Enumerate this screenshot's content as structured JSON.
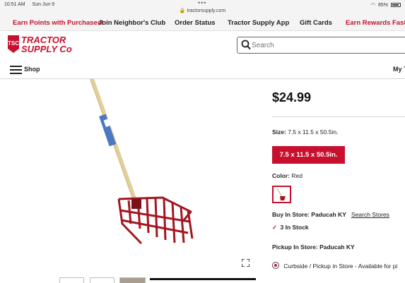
{
  "status_bar": {
    "time": "10:51 AM",
    "date": "Sun Jun 9",
    "url": "tractorsupply.com",
    "battery": "85%"
  },
  "promo_bar": {
    "earn_points": "Earn Points with Purchases!",
    "neighbors_club": "Join Neighbor's Club",
    "order_status": "Order Status",
    "app": "Tractor Supply App",
    "gift_cards": "Gift Cards",
    "earn_rewards": "Earn Rewards Faster"
  },
  "header": {
    "logo_text": "TRACTOR SUPPLY CO",
    "logo_badge": "TSC",
    "search_placeholder": "Search"
  },
  "nav": {
    "shop": "Shop",
    "my_account": "My T"
  },
  "product": {
    "price": "$24.99",
    "size_label": "Size:",
    "size_value": "7.5 x 11.5 x 50.5in.",
    "size_option": "7.5 x 11.5 x 50.5in.",
    "color_label": "Color:",
    "color_value": "Red",
    "buy_in_store_label": "Buy In Store:",
    "store_name": "Paducah KY",
    "search_stores": "Search Stores",
    "stock_status": "3 In Stock",
    "pickup_label": "Pickup In Store:",
    "pickup_store": "Paducah KY",
    "curbside": "Curbside / Pickup in Store - Available for pi"
  },
  "colors": {
    "brand_red": "#c8102e"
  },
  "icons": {
    "expand": "expand-icon",
    "search": "search-icon",
    "menu": "hamburger-icon",
    "check": "check-icon"
  }
}
